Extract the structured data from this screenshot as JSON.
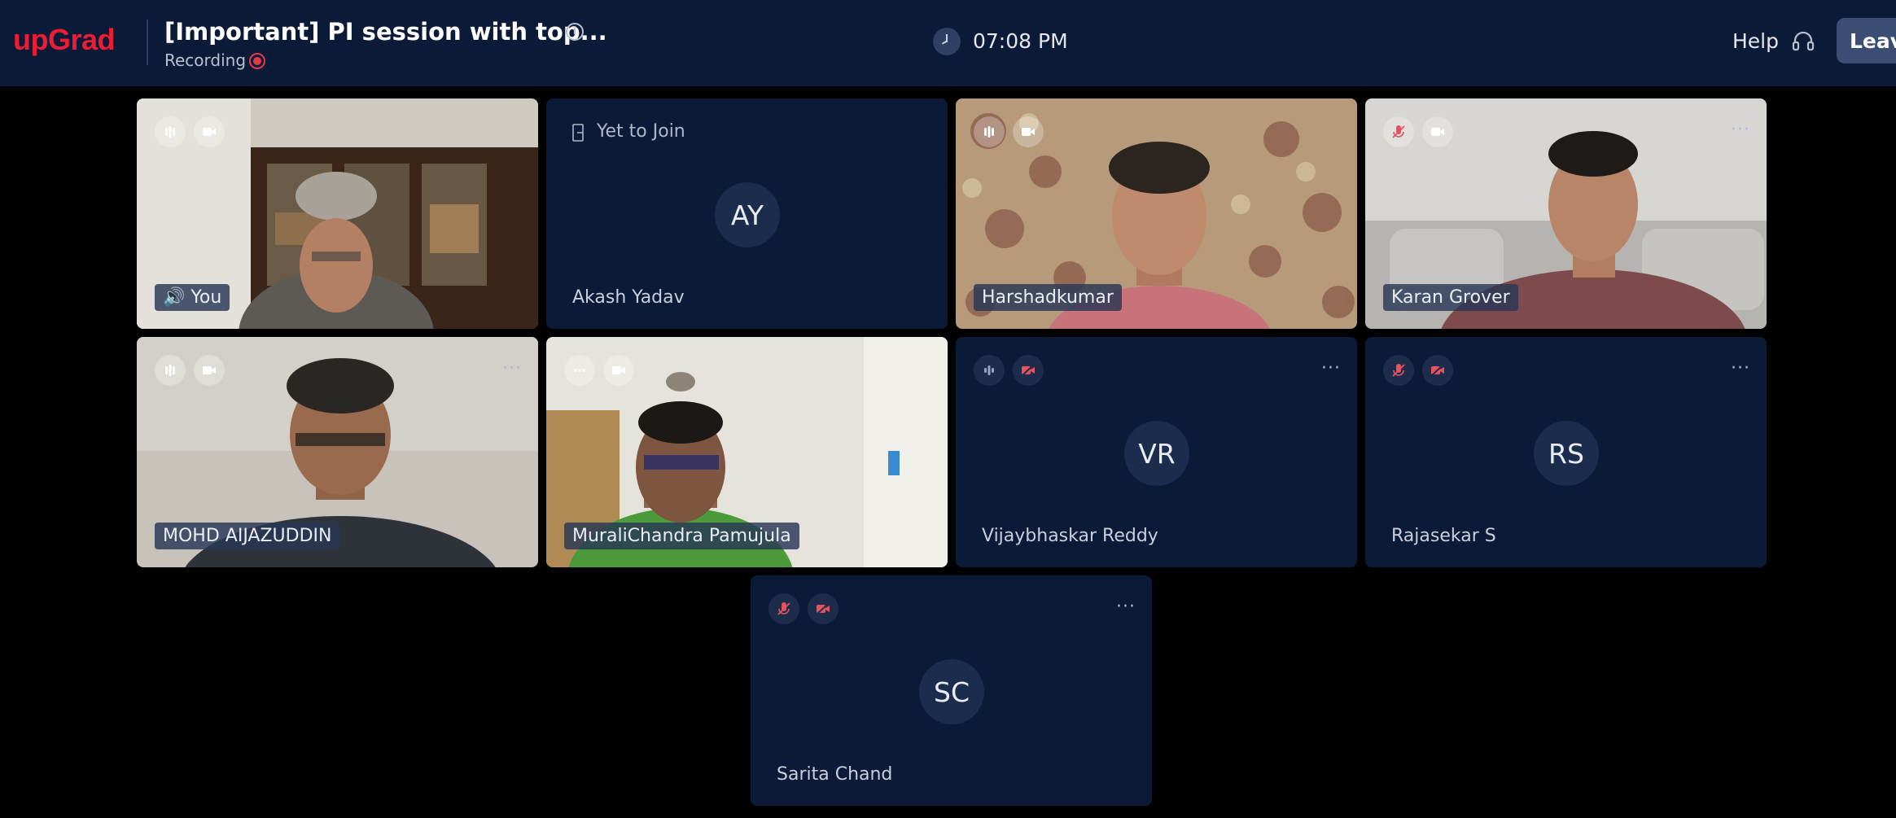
{
  "header": {
    "logo": "upGrad",
    "title": "[Important] PI session with top...",
    "recording_label": "Recording",
    "time": "07:08 PM",
    "help_label": "Help",
    "leave_label": "Leave",
    "brand_color": "#ec1c35",
    "bar_color": "#0b1a37"
  },
  "participants": [
    {
      "name": "You",
      "video": true,
      "mic": "active",
      "camera": "on"
    },
    {
      "name": "Akash Yadav",
      "status": "Yet to Join",
      "initials": "AY",
      "video": false
    },
    {
      "name": "Harshadkumar",
      "video": true,
      "mic": "active",
      "camera": "on"
    },
    {
      "name": "Karan Grover",
      "video": true,
      "mic": "muted",
      "camera": "on"
    },
    {
      "name": "MOHD AIJAZUDDIN",
      "video": true,
      "mic": "active",
      "camera": "on"
    },
    {
      "name": "MuraliChandra Pamujula",
      "video": true,
      "mic": "more",
      "camera": "on"
    },
    {
      "name": "Vijaybhaskar Reddy",
      "initials": "VR",
      "video": false,
      "mic": "active",
      "camera": "off"
    },
    {
      "name": "Rajasekar S",
      "initials": "RS",
      "video": false,
      "mic": "muted",
      "camera": "off"
    },
    {
      "name": "Sarita Chand",
      "initials": "SC",
      "video": false,
      "mic": "muted",
      "camera": "off"
    }
  ]
}
